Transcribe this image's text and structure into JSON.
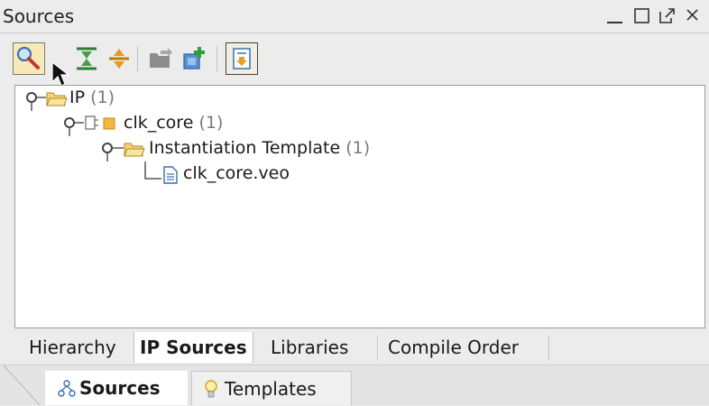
{
  "window": {
    "title": "Sources",
    "controls": [
      "minimize-icon",
      "maximize-icon",
      "float-icon",
      "close-icon"
    ]
  },
  "toolbar": {
    "buttons": [
      {
        "name": "search-button",
        "icon": "search-icon"
      },
      {
        "name": "collapse-all-button",
        "icon": "collapse-all-icon"
      },
      {
        "name": "expand-all-button",
        "icon": "expand-all-icon"
      },
      {
        "name": "add-sources-button",
        "icon": "folder-add-icon"
      },
      {
        "name": "add-ip-button",
        "icon": "ip-add-icon"
      },
      {
        "name": "show-hierarchy-toggle",
        "icon": "document-arrow-icon"
      }
    ]
  },
  "tree": {
    "nodes": [
      {
        "label": "IP",
        "count": "(1)"
      },
      {
        "label": "clk_core",
        "count": "(1)"
      },
      {
        "label": "Instantiation Template",
        "count": "(1)"
      },
      {
        "label": "clk_core.veo",
        "count": ""
      }
    ]
  },
  "view_tabs": [
    "Hierarchy",
    "IP Sources",
    "Libraries",
    "Compile Order"
  ],
  "selected_view_tab": "IP Sources",
  "panel_tabs": [
    "Sources",
    "Templates"
  ],
  "selected_panel_tab": "Sources",
  "colors": {
    "folder": "#e8b84a",
    "accent_selected": "#f8e9b8",
    "count_text": "#7a7a7a"
  }
}
